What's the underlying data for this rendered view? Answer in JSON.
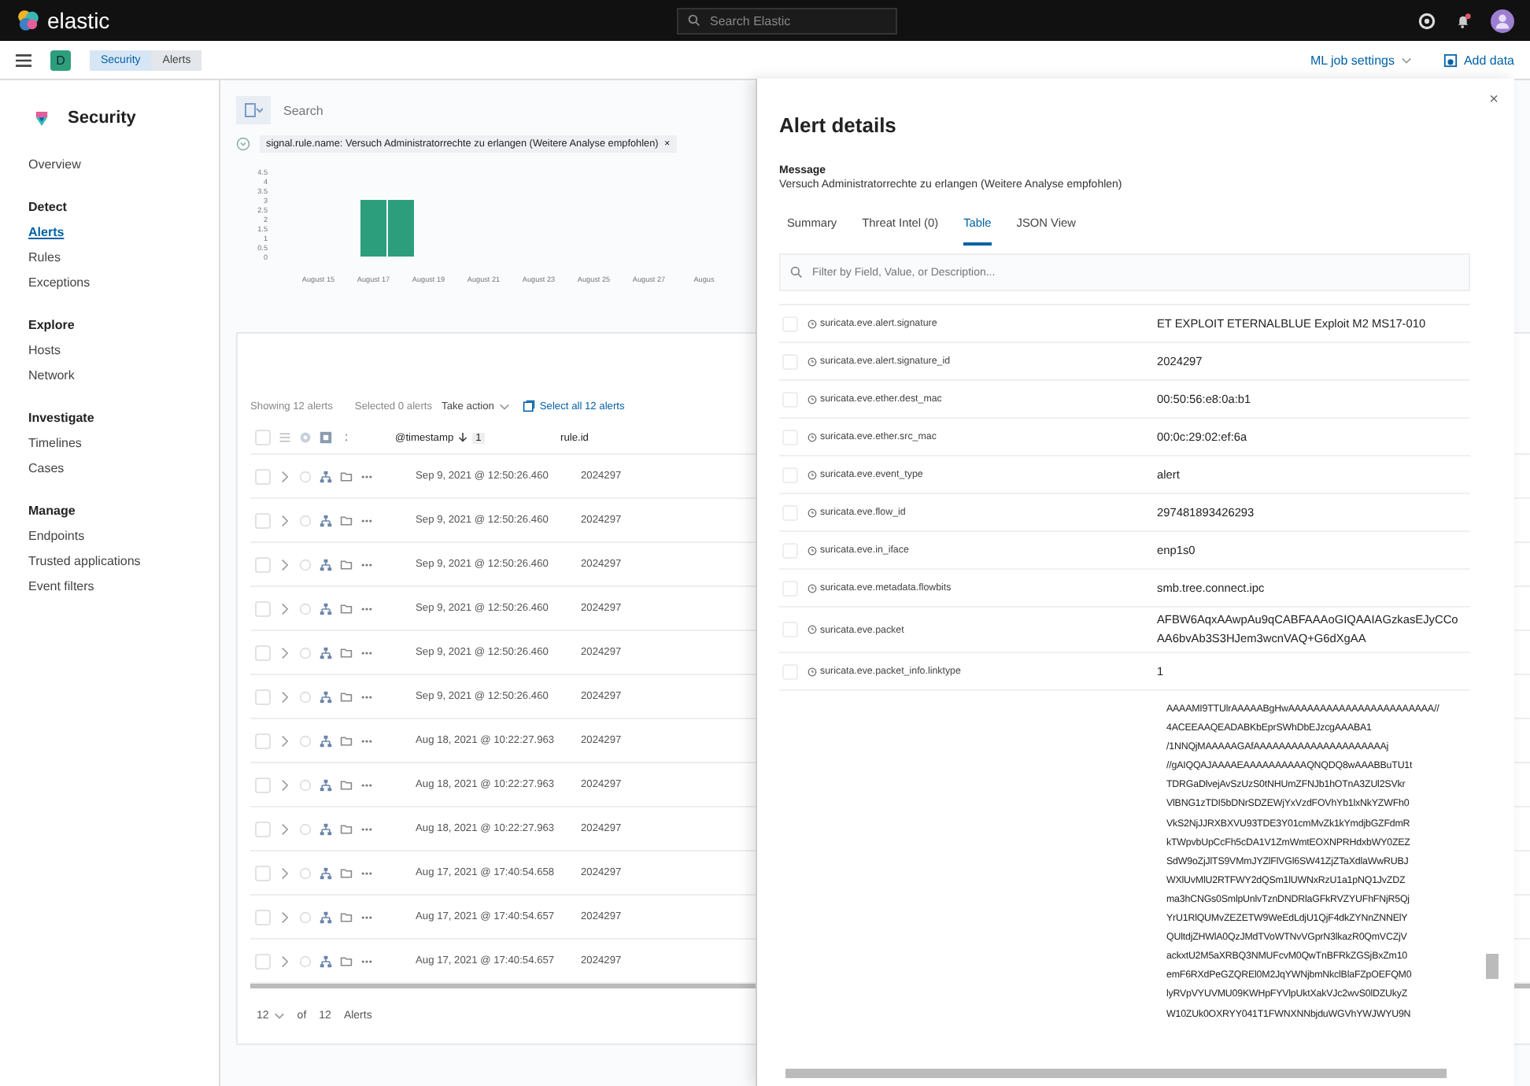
{
  "header": {
    "logo": "elastic",
    "search": {
      "placeholder": "Search Elastic"
    }
  },
  "breadcrumbs": {
    "space": "D",
    "items": [
      {
        "label": "Security"
      },
      {
        "label": "Alerts"
      }
    ],
    "actions": [
      {
        "label": "ML job settings",
        "kind": "dropdown"
      },
      {
        "label": "Add data",
        "kind": "add"
      }
    ]
  },
  "sidebar": {
    "title": "Security",
    "groups": [
      {
        "items": [
          {
            "label": "Overview",
            "selected": false
          }
        ]
      },
      {
        "title": "Detect",
        "items": [
          {
            "label": "Alerts",
            "selected": true
          },
          {
            "label": "Rules",
            "selected": false
          },
          {
            "label": "Exceptions",
            "selected": false
          }
        ]
      },
      {
        "title": "Explore",
        "items": [
          {
            "label": "Hosts",
            "selected": false
          },
          {
            "label": "Network",
            "selected": false
          }
        ]
      },
      {
        "title": "Investigate",
        "items": [
          {
            "label": "Timelines",
            "selected": false
          },
          {
            "label": "Cases",
            "selected": false
          }
        ]
      },
      {
        "title": "Manage",
        "items": [
          {
            "label": "Endpoints",
            "selected": false
          },
          {
            "label": "Trusted applications",
            "selected": false
          },
          {
            "label": "Event filters",
            "selected": false
          }
        ]
      }
    ]
  },
  "query": {
    "placeholder": "Search",
    "filter": "signal.rule.name: Versuch Administratorrechte zu erlangen (Weitere Analyse empfohlen)",
    "filter_close": "×"
  },
  "histogram": {
    "chart_data": {
      "type": "bar",
      "categories": [
        null,
        "August 15",
        null,
        "August 17",
        null,
        "August 19",
        null,
        "August 21",
        null,
        "August 23",
        null,
        "August 25",
        null,
        "August 27",
        null,
        "Augus"
      ],
      "values": [
        0,
        0,
        0,
        3,
        3,
        0,
        0,
        0,
        0,
        0,
        0,
        0,
        0,
        0,
        0,
        0
      ],
      "ylim": [
        0,
        4.5
      ],
      "yticks": [
        0,
        0.5,
        1,
        1.5,
        2,
        2.5,
        3,
        3.5,
        4,
        4.5
      ]
    }
  },
  "alerts_table": {
    "showing": "Showing 12 alerts",
    "selected": "Selected 0 alerts",
    "take_action": "Take action",
    "select_all": "Select all 12 alerts",
    "all_checked": false,
    "columns": [
      {
        "label": "@timestamp",
        "sort_count": "1"
      },
      {
        "label": "rule.id"
      }
    ],
    "rows": [
      {
        "timestamp": "Sep 9, 2021 @ 12:50:26.460",
        "rule_id": "2024297",
        "checked": false
      },
      {
        "timestamp": "Sep 9, 2021 @ 12:50:26.460",
        "rule_id": "2024297",
        "checked": false
      },
      {
        "timestamp": "Sep 9, 2021 @ 12:50:26.460",
        "rule_id": "2024297",
        "checked": false
      },
      {
        "timestamp": "Sep 9, 2021 @ 12:50:26.460",
        "rule_id": "2024297",
        "checked": false
      },
      {
        "timestamp": "Sep 9, 2021 @ 12:50:26.460",
        "rule_id": "2024297",
        "checked": false
      },
      {
        "timestamp": "Sep 9, 2021 @ 12:50:26.460",
        "rule_id": "2024297",
        "checked": false
      },
      {
        "timestamp": "Aug 18, 2021 @ 10:22:27.963",
        "rule_id": "2024297",
        "checked": false
      },
      {
        "timestamp": "Aug 18, 2021 @ 10:22:27.963",
        "rule_id": "2024297",
        "checked": false
      },
      {
        "timestamp": "Aug 18, 2021 @ 10:22:27.963",
        "rule_id": "2024297",
        "checked": false
      },
      {
        "timestamp": "Aug 17, 2021 @ 17:40:54.658",
        "rule_id": "2024297",
        "checked": false
      },
      {
        "timestamp": "Aug 17, 2021 @ 17:40:54.657",
        "rule_id": "2024297",
        "checked": false
      },
      {
        "timestamp": "Aug 17, 2021 @ 17:40:54.657",
        "rule_id": "2024297",
        "checked": false
      }
    ],
    "pagination": {
      "page_size": "12",
      "of": "of",
      "total": "12",
      "unit": "Alerts"
    }
  },
  "flyout": {
    "close": "×",
    "title": "Alert details",
    "message_label": "Message",
    "message": "Versuch Administratorrechte zu erlangen (Weitere Analyse empfohlen)",
    "tabs": [
      {
        "label": "Summary",
        "selected": false
      },
      {
        "label": "Threat Intel (0)",
        "selected": false
      },
      {
        "label": "Table",
        "selected": true
      },
      {
        "label": "JSON View",
        "selected": false
      }
    ],
    "filter": {
      "placeholder": "Filter by Field, Value, or Description..."
    },
    "rows": [
      {
        "field": "suricata.eve.alert.signature",
        "value": "ET EXPLOIT ETERNALBLUE Exploit M2 MS17-010",
        "checked": false
      },
      {
        "field": "suricata.eve.alert.signature_id",
        "value": "2024297",
        "checked": false
      },
      {
        "field": "suricata.eve.ether.dest_mac",
        "value": "00:50:56:e8:0a:b1",
        "checked": false
      },
      {
        "field": "suricata.eve.ether.src_mac",
        "value": "00:0c:29:02:ef:6a",
        "checked": false
      },
      {
        "field": "suricata.eve.event_type",
        "value": "alert",
        "checked": false
      },
      {
        "field": "suricata.eve.flow_id",
        "value": "297481893426293",
        "checked": false
      },
      {
        "field": "suricata.eve.in_iface",
        "value": "enp1s0",
        "checked": false
      },
      {
        "field": "suricata.eve.metadata.flowbits",
        "value": "smb.tree.connect.ipc",
        "checked": false
      },
      {
        "field": "suricata.eve.packet",
        "value": "AFBW6AqxAAwpAu9qCABFAAAoGIQAAIAGzkasEJyCCo\nAA6bvAb3S3HJem3wcnVAQ+G6dXgAA",
        "checked": false
      },
      {
        "field": "suricata.eve.packet_info.linktype",
        "value": "1",
        "checked": false
      }
    ],
    "payload": "AAAAMI9TTUlrAAAAABgHwAAAAAAAAAAAAAAAAAAAAAAA//\n4ACEEAAQEADABKbEprSWhDbEJzcgAAABA1\n/1NNQjMAAAAAGAfAAAAAAAAAAAAAAAAAAAAAj\n//gAIQQAJAAAAEAAAAAAAAAAQNQDQ8wAAABBuTU1t\nTDRGaDlvejAvSzUzS0tNHUmZFNJb1hOTnA3ZUl2SVkr\nVlBNG1zTDI5bDNrSDZEWjYxVzdFOVhYb1lxNkYZWFh0\nVkS2NjJJRXBXVU93TDE3Y01cmMvZk1kYmdjbGZFdmR\nkTWpvbUpCcFh5cDA1V1ZmWmtEOXNPRHdxbWY0ZEZ\nSdW9oZjJlTS9VMmJYZlFlVGl6SW41ZjZTaXdlaWwRUBJ\nWXlUvMlU2RTFWY2dQSm1lUWNxRzU1a1pNQ1JvZDZ\nma3hCNGs0SmlpUnlvTznDNDRlaGFkRVZYUFhFNjR5Qj\nYrU1RlQUMvZEZETW9WeEdLdjU1QjF4dkZYNnZNNElY\nQUltdjZHWlA0QzJMdTVoWTNvVGprN3lkazR0QmVCZjV\nackxtU2M5aXRBQ3NMUFcvM0QwTnBFRkZGSjBxZm10\nemF6RXdPeGZQREl0M2JqYWNjbmNkclBlaFZpOEFQM0\nlyRVpVYUVMU09KWHpFYVlpUktXakVJc2wvS0lDZUkyZ\nW10ZUk0OXRYY041T1FWNXNNbjduWGVhYWJWYU9N"
  }
}
